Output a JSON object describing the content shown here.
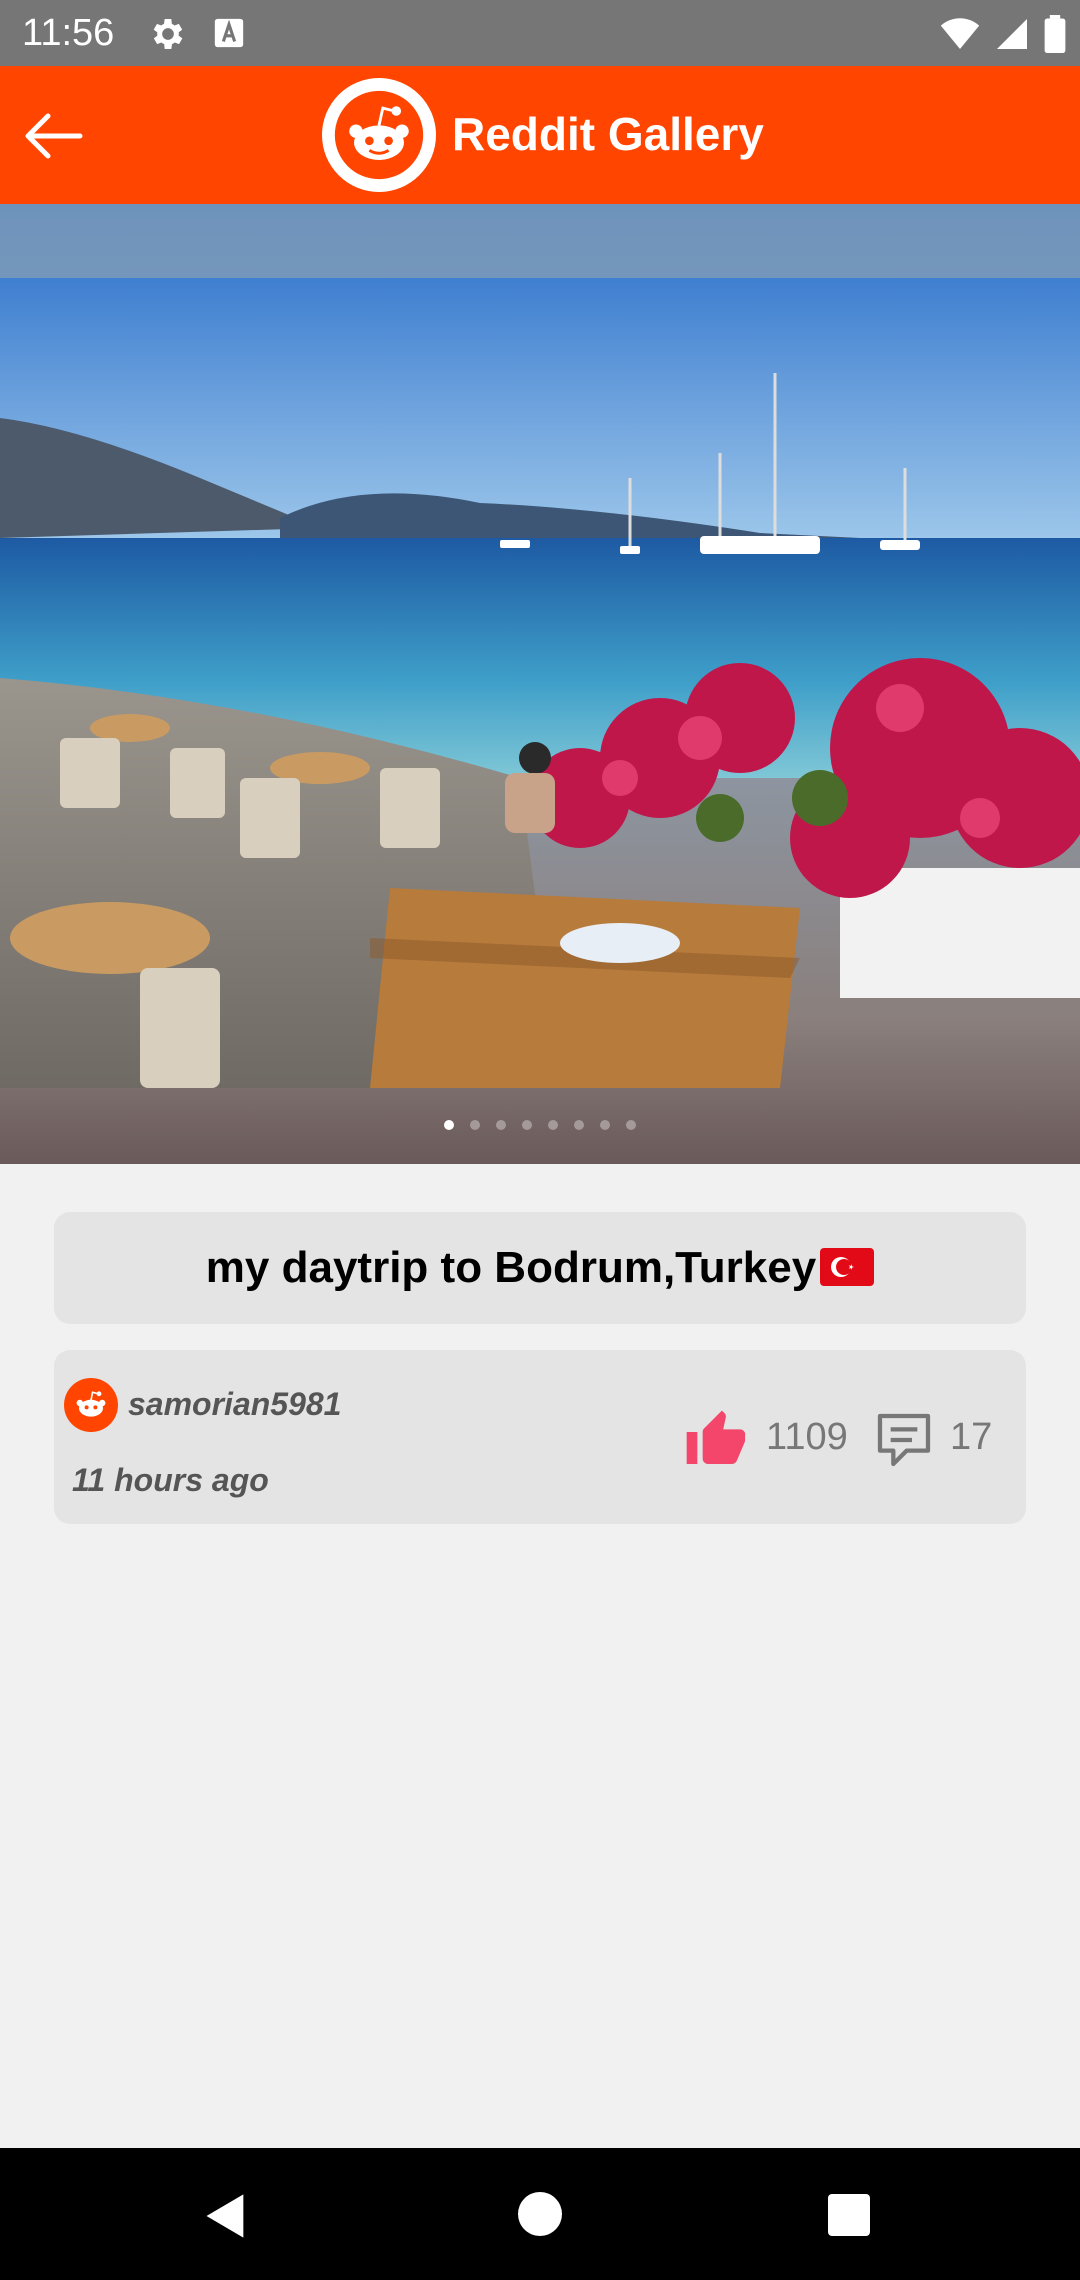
{
  "status_bar": {
    "time": "11:56",
    "icons": [
      "settings-icon",
      "font-icon",
      "wifi-icon",
      "signal-icon",
      "battery-icon"
    ]
  },
  "app_bar": {
    "title": "Reddit Gallery",
    "back_icon": "arrow-left-icon",
    "logo_icon": "reddit-logo-icon",
    "accent": "#ff4500"
  },
  "gallery": {
    "page_count": 8,
    "current_page": 1
  },
  "post": {
    "title": "my daytrip to Bodrum,Turkey",
    "author": "samorian5981",
    "time_ago": "11 hours ago",
    "upvotes": "1109",
    "comments": "17",
    "upvote_color": "#f4456a"
  },
  "nav_bar": {
    "icons": [
      "back-triangle-icon",
      "home-circle-icon",
      "recents-square-icon"
    ]
  }
}
